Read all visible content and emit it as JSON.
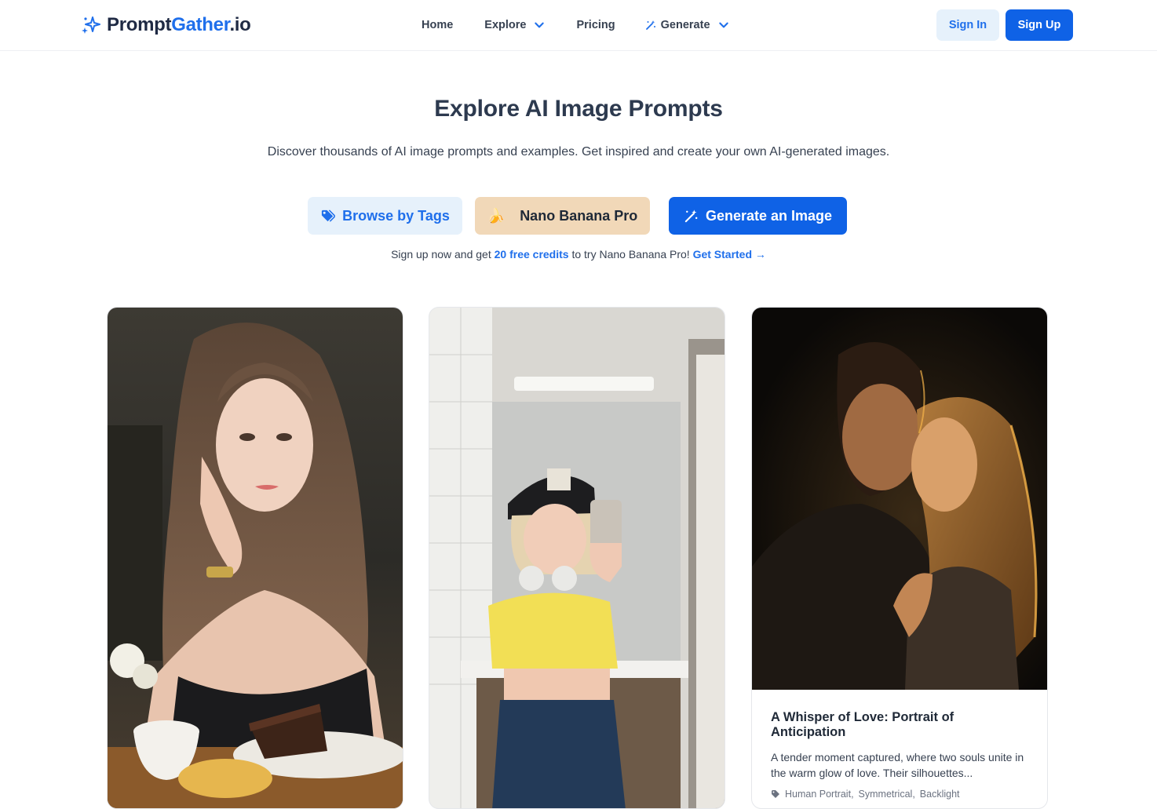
{
  "brand": {
    "name_part1": "Prompt",
    "name_part2": "Gather",
    "name_part3": ".io"
  },
  "nav": {
    "home": "Home",
    "explore": "Explore",
    "pricing": "Pricing",
    "generate": "Generate"
  },
  "auth": {
    "sign_in": "Sign In",
    "sign_up": "Sign Up"
  },
  "hero": {
    "title": "Explore AI Image Prompts",
    "subtitle": "Discover thousands of AI image prompts and examples. Get inspired and create your own AI-generated images."
  },
  "cta": {
    "browse_tags": "Browse by Tags",
    "nano_banana": "Nano Banana Pro",
    "nano_emoji": "🍌",
    "generate": "Generate an Image"
  },
  "promo": {
    "prefix": "Sign up now and get ",
    "credits": "20 free credits",
    "middle": " to try Nano Banana Pro! ",
    "link": "Get Started →"
  },
  "cards": [
    {
      "image": "woman-cafe-portrait"
    },
    {
      "image": "mirror-selfie-bathroom"
    },
    {
      "image": "couple-backlit-portrait",
      "title": "A Whisper of Love: Portrait of Anticipation",
      "description": "A tender moment captured, where two souls unite in the warm glow of love. Their silhouettes...",
      "tags": [
        "Human Portrait",
        "Symmetrical",
        "Backlight"
      ]
    }
  ],
  "colors": {
    "brand_blue": "#1f6feb",
    "primary_button": "#0f62e6",
    "nano_bg": "#f1d8b8"
  },
  "icons": [
    "sparkles-logo-icon",
    "chevron-down-icon",
    "magic-wand-icon",
    "tag-icon",
    "banana-icon"
  ]
}
